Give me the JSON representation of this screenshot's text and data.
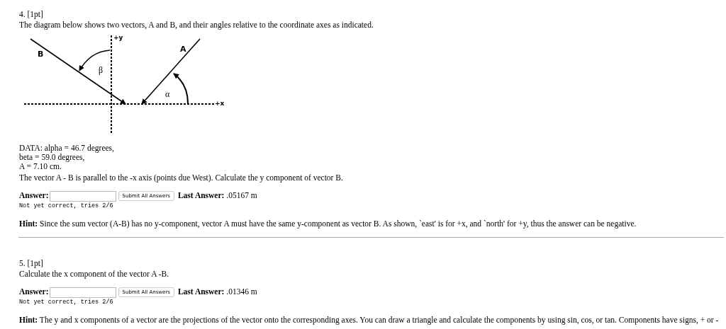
{
  "questions": [
    {
      "heading": "4. [1pt]",
      "intro": "The diagram below shows two vectors, A and B, and their angles relative to the coordinate axes as indicated.",
      "diagram": {
        "y_axis_label": "+y",
        "x_axis_label": "+x",
        "vector_a_label": "A",
        "vector_b_label": "B",
        "beta_label": "β",
        "alpha_label": "α"
      },
      "data_lines": [
        "DATA: alpha = 46.7 degrees,",
        "beta = 59.0 degrees,",
        "A = 7.10 cm."
      ],
      "prompt": "The vector A - B is parallel to the -x axis (points due West). Calculate the y component of vector B.",
      "answer_label": "Answer:",
      "submit_button": "Submit All Answers",
      "last_answer": "**Last Answer:** .05167 m",
      "status": "Not yet correct, tries 2/6",
      "hint": "**Hint:** Since the sum vector (A-B) has no y-component, vector A must have the same y-component as vector B. As shown, `east' is for +x, and `north' for +y, thus the answer can be negative."
    },
    {
      "heading": "5. [1pt]",
      "prompt": "Calculate the x component of the vector A -B.",
      "answer_label": "Answer:",
      "submit_button": "Submit All Answers",
      "last_answer": "**Last Answer:** .01346 m",
      "status": "Not yet correct, tries 2/6",
      "hint": "**Hint:** The y and x components of a vector are the projections of the vector onto the corresponding axes. You can draw a triangle and calculate the components by using sin, cos, or tan. Components have signs, + or -"
    }
  ]
}
